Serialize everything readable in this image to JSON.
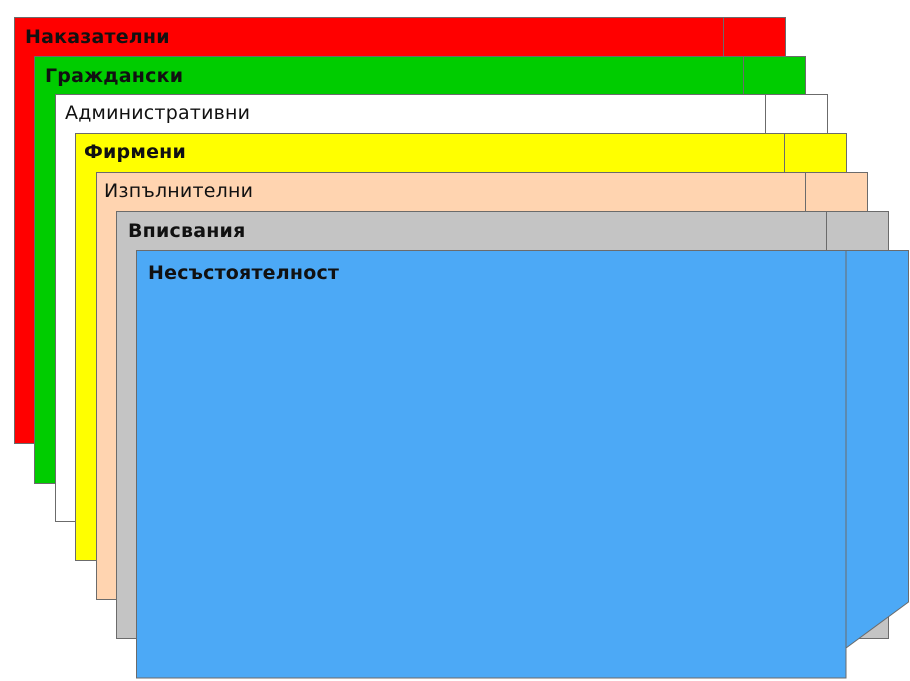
{
  "folders": [
    {
      "label": "Наказателни",
      "color": "#ff0000"
    },
    {
      "label": "Граждански",
      "color": "#00cc00"
    },
    {
      "label": "Административни",
      "color": "#ffffff"
    },
    {
      "label": "Фирмени",
      "color": "#ffff00"
    },
    {
      "label": "Изпълнителни",
      "color": "#ffd4b0"
    },
    {
      "label": "Вписвания",
      "color": "#c4c4c4"
    },
    {
      "label": "Несъстоятелност",
      "color": "#4ca9f6"
    }
  ]
}
